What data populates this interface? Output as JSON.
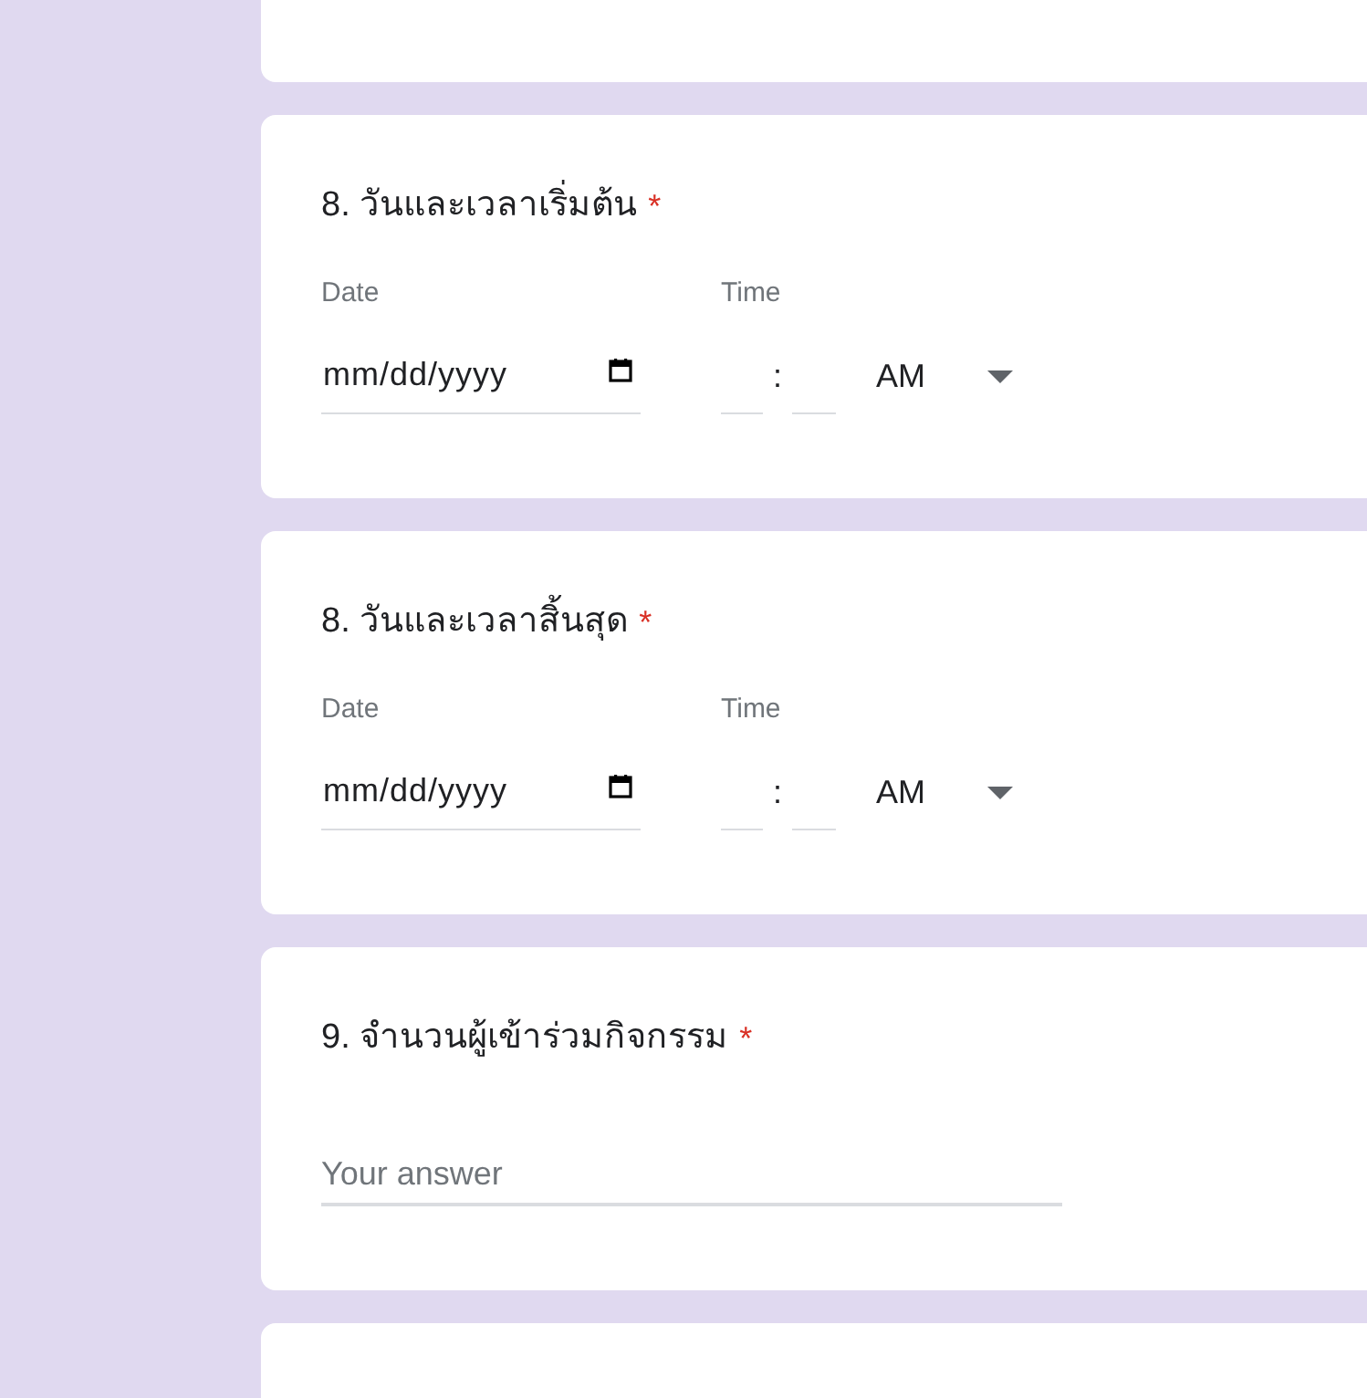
{
  "cards": [
    {
      "kind": "blank"
    },
    {
      "kind": "datetime",
      "title": "8. วันและเวลาเริ่มต้น",
      "required": true,
      "date_label": "Date",
      "date_placeholder": "mm/dd/yyyy",
      "time_label": "Time",
      "time_separator": ":",
      "period": "AM"
    },
    {
      "kind": "datetime",
      "title": "8. วันและเวลาสิ้นสุด",
      "required": true,
      "date_label": "Date",
      "date_placeholder": "mm/dd/yyyy",
      "time_label": "Time",
      "time_separator": ":",
      "period": "AM"
    },
    {
      "kind": "text",
      "title": "9. จำนวนผู้เข้าร่วมกิจกรรม",
      "required": true,
      "placeholder": "Your answer"
    },
    {
      "kind": "blank"
    }
  ],
  "required_mark": "*"
}
